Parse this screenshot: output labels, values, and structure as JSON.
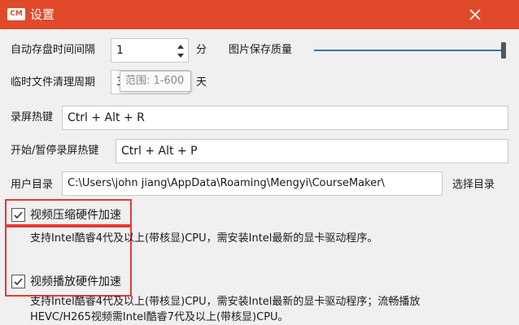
{
  "window": {
    "logo_text": "CM",
    "title": "设置"
  },
  "settings": {
    "autosave": {
      "label": "自动存盘时间间隔",
      "value": "1",
      "unit": "分"
    },
    "image_quality": {
      "label": "图片保存质量",
      "level": 1.0
    },
    "cleanup": {
      "label": "临时文件清理周期",
      "value": "3",
      "unit": "天",
      "tooltip": "范围: 1-600"
    },
    "record_hotkey": {
      "label": "录屏热键",
      "value": "Ctrl + Alt + R"
    },
    "pause_hotkey": {
      "label": "开始/暂停录屏热键",
      "value": "Ctrl + Alt + P"
    },
    "user_dir": {
      "label": "用户目录",
      "value": "C:\\Users\\john jiang\\AppData\\Roaming\\Mengyi\\CourseMaker\\",
      "browse_label": "选择目录"
    },
    "video_compress_hw": {
      "label": "视频压缩硬件加速",
      "checked": true,
      "desc": "支持Intel酷睿4代及以上(带核显)CPU，需安装Intel最新的显卡驱动程序。"
    },
    "video_play_hw": {
      "label": "视频播放硬件加速",
      "checked": true,
      "desc_line1": "支持Intel酷睿4代及以上(带核显)CPU，需安装Intel最新的显卡驱动程序；流畅播放",
      "desc_line2": "HEVC/H265视频需Intel酷睿7代及以上(带核显)CPU。"
    }
  },
  "colors": {
    "titlebar": "#e04a2a",
    "highlight": "#e53935",
    "slider": "#3a6fb0"
  }
}
